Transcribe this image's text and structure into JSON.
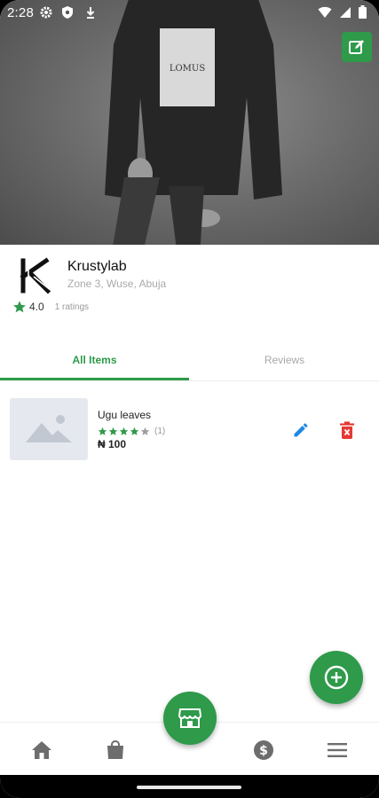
{
  "status_bar": {
    "time": "2:28",
    "left_icons": [
      "gear-icon",
      "shield-icon",
      "download-icon"
    ],
    "right_icons": [
      "wifi-icon",
      "signal-icon",
      "battery-icon"
    ]
  },
  "cover": {
    "edit_icon": "edit-icon"
  },
  "store": {
    "name": "Krustylab",
    "address": "Zone 3, Wuse, Abuja",
    "rating": "4.0",
    "ratings_count": "1 ratings"
  },
  "tabs": [
    {
      "label": "All Items",
      "active": true
    },
    {
      "label": "Reviews",
      "active": false
    }
  ],
  "items": [
    {
      "name": "Ugu leaves",
      "stars": 4,
      "max_stars": 5,
      "review_count": "(1)",
      "price": "₦ 100"
    }
  ],
  "fab": {
    "add_icon": "add-circle-icon",
    "store_icon": "storefront-icon"
  },
  "bottom_nav": [
    {
      "icon": "home-icon"
    },
    {
      "icon": "shopping-bag-icon"
    },
    {
      "icon": "dollar-icon"
    },
    {
      "icon": "menu-icon"
    }
  ],
  "colors": {
    "accent": "#2e9a4a",
    "edit_blue": "#1e88e5",
    "delete_red": "#e53935",
    "inactive_tab": "#a8a8a8"
  }
}
